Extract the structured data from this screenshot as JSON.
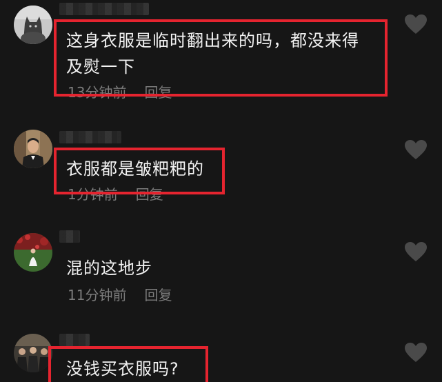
{
  "comments": [
    {
      "text_line1": "这身衣服是临时翻出来的吗，都没来得",
      "text_line2": "及熨一下",
      "time": "13分钟前",
      "reply_label": "回复",
      "avatar": "cat-avatar",
      "highlighted": true
    },
    {
      "text_line1": "衣服都是皱粑粑的",
      "time": "1分钟前",
      "reply_label": "回复",
      "avatar": "man-in-suit-avatar",
      "highlighted": true
    },
    {
      "text_line1": "混的这地步",
      "time": "11分钟前",
      "reply_label": "回复",
      "avatar": "woman-in-field-avatar",
      "highlighted": false
    },
    {
      "text_line1": "没钱买衣服吗?",
      "avatar": "group-photo-avatar",
      "highlighted": true
    }
  ],
  "icons": {
    "like": "heart-icon"
  },
  "colors": {
    "background": "#161616",
    "highlight_border": "#e5242f",
    "text": "#f2f2f2",
    "meta": "#7b7b7b",
    "like_icon": "#4a4a4a"
  }
}
